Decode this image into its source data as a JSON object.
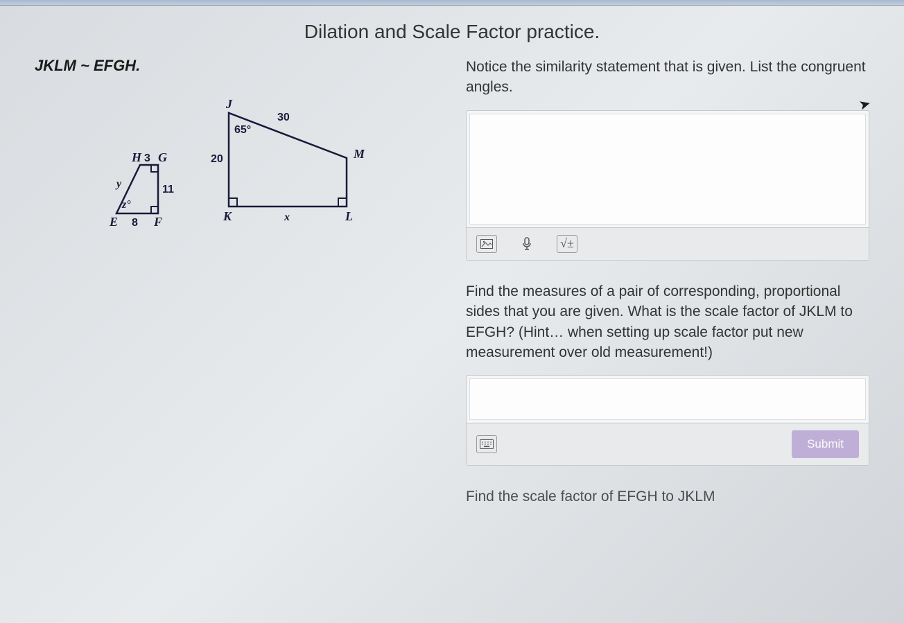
{
  "title": "Dilation and Scale Factor practice.",
  "similarity": "JKLM ~ EFGH.",
  "diagram": {
    "small": {
      "H": "H",
      "G": "G",
      "E": "E",
      "F": "F",
      "HG": "3",
      "GF": "11",
      "EF": "8",
      "EH_var": "y",
      "angleE_var": "z°"
    },
    "large": {
      "J": "J",
      "K": "K",
      "L": "L",
      "M": "M",
      "JK": "20",
      "JM": "30",
      "KL_var": "x",
      "angleJ": "65°"
    }
  },
  "q1": {
    "prompt": "Notice the similarity statement that is given. List the congruent angles.",
    "math_label": "√±"
  },
  "q2": {
    "prompt": "Find the measures of a pair of corresponding, proportional sides that you are given.  What is the scale factor of JKLM to EFGH?  (Hint… when setting up scale factor put new measurement over old measurement!)",
    "submit": "Submit"
  },
  "q3": {
    "prompt": "Find the scale factor of EFGH to JKLM"
  }
}
